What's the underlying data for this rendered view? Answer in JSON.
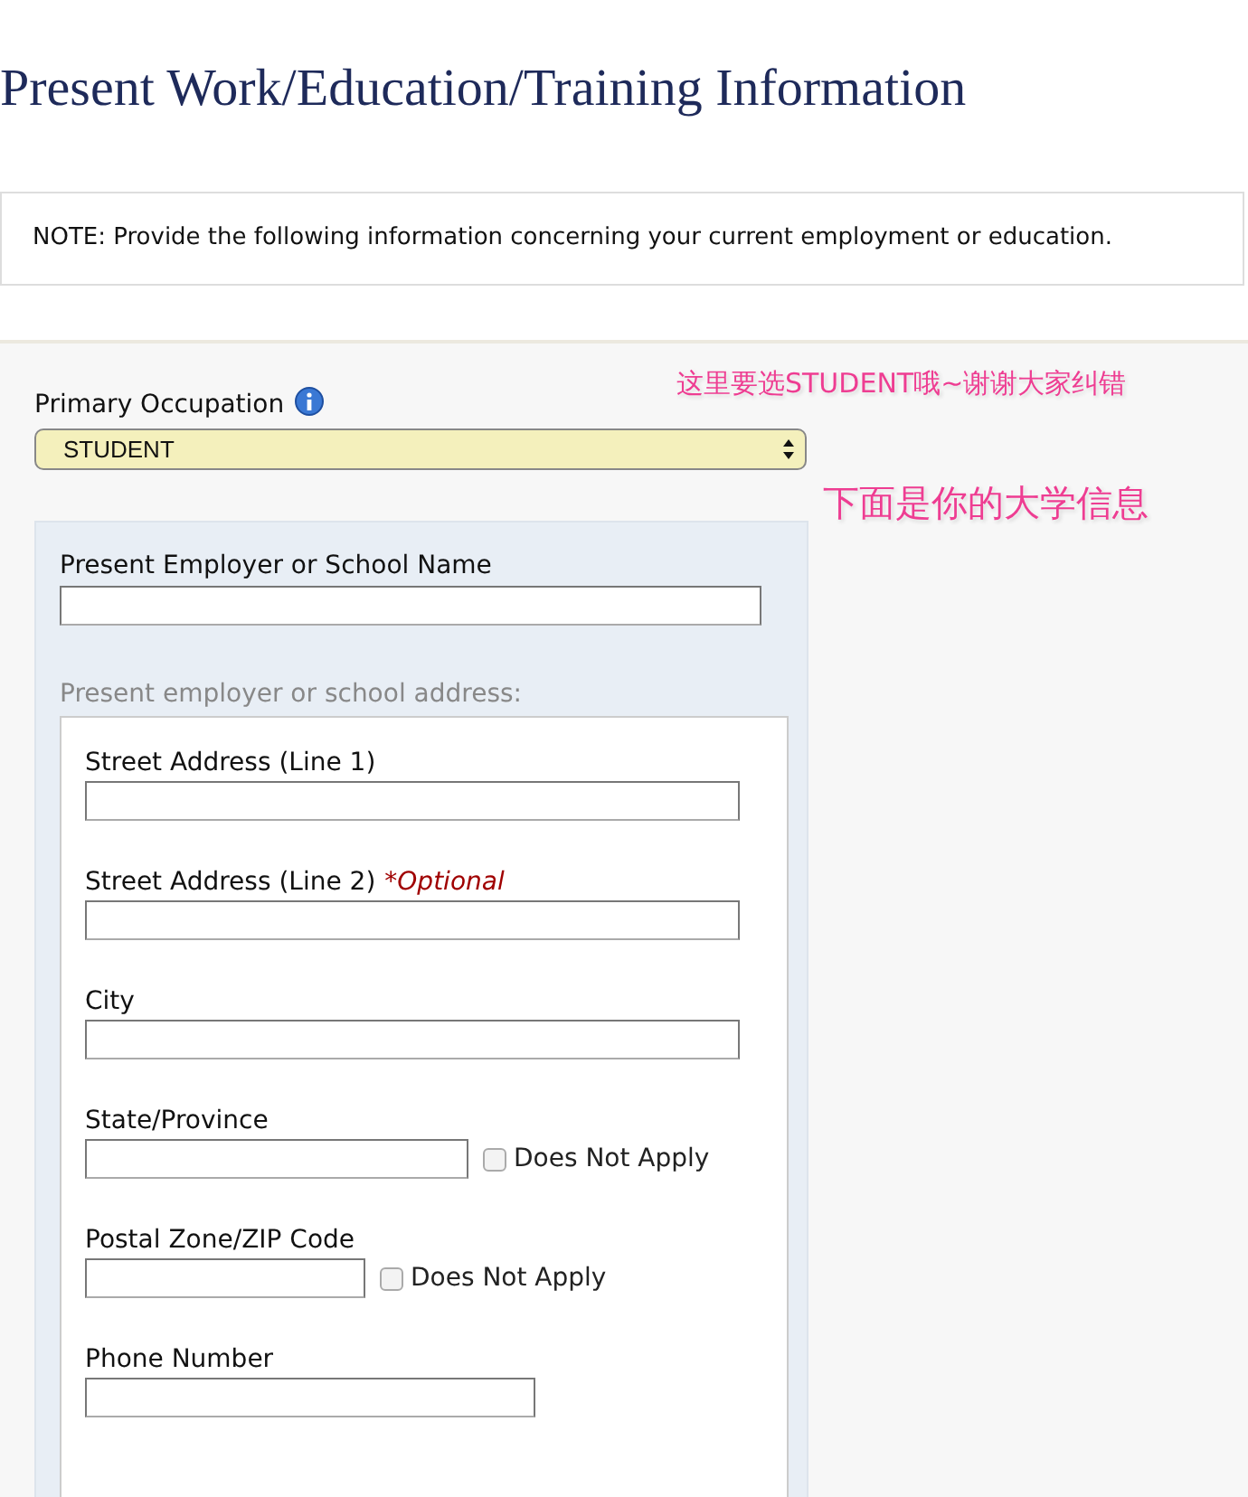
{
  "page_title": "Present Work/Education/Training Information",
  "note": "NOTE: Provide the following information concerning your current employment or education.",
  "primary_occupation": {
    "label": "Primary Occupation",
    "value": "STUDENT"
  },
  "annotations": [
    {
      "text": "这里要选STUDENT哦~谢谢大家纠错"
    },
    {
      "text": "下面是你的大学信息"
    }
  ],
  "employer_name": {
    "label": "Present Employer or School Name"
  },
  "address_heading": "Present employer or school address:",
  "address_fields": [
    {
      "label": "Street Address (Line 1)",
      "kind": "full"
    },
    {
      "label": "Street Address (Line 2)",
      "optional": "*Optional",
      "kind": "full"
    },
    {
      "label": "City",
      "kind": "full"
    },
    {
      "label": "State/Province",
      "kind": "state",
      "checkbox": {
        "label": "Does Not Apply",
        "checked": false
      }
    },
    {
      "label": "Postal Zone/ZIP Code",
      "kind": "zip",
      "checkbox": {
        "label": "Does Not Apply",
        "checked": false
      }
    },
    {
      "label": "Phone Number",
      "kind": "phone"
    }
  ]
}
